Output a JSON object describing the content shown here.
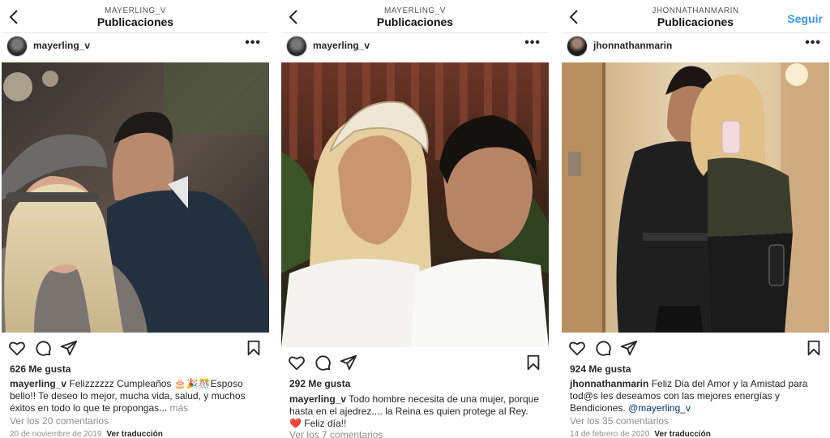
{
  "posts": [
    {
      "header_username": "MAYERLING_V",
      "header_title": "Publicaciones",
      "author": "mayerling_v",
      "menu_label": "•••",
      "likes": "626 Me gusta",
      "caption_user": "mayerling_v",
      "caption_text": "Felizzzzzz Cumpleaños 🎂🎉🎊Esposo bello!! Te deseo lo mejor, mucha vida, salud, y muchos éxitos en todo lo que te propongas...",
      "more_label": "más",
      "comments": "Ver los 20 comentarios",
      "date": "20 de noviembre de 2019",
      "translate": "Ver traducción"
    },
    {
      "header_username": "MAYERLING_V",
      "header_title": "Publicaciones",
      "author": "mayerling_v",
      "menu_label": "•••",
      "likes": "292 Me gusta",
      "caption_user": "mayerling_v",
      "caption_text": "Todo hombre necesita de una mujer, porque hasta en el ajedrez.... la Reina es quien protege al Rey.",
      "caption_heart": "❤️",
      "caption_tail": "Feliz día!!",
      "comments": "Ver los 7 comentarios"
    },
    {
      "header_username": "JHONNATHANMARIN",
      "header_title": "Publicaciones",
      "follow_label": "Seguir",
      "author": "jhonnathanmarin",
      "menu_label": "•••",
      "likes": "924 Me gusta",
      "caption_user": "jhonnathanmarin",
      "caption_text": "Feliz Dia del Amor y la Amistad para tod@s les deseamos con las mejores energías y Bendiciones.",
      "caption_mention": "@mayerling_v",
      "comments": "Ver los 35 comentarios",
      "date": "14 de febrero de 2020",
      "translate": "Ver traducción"
    }
  ],
  "icons": [
    "chevron-left-icon",
    "more-icon",
    "heart-icon",
    "comment-icon",
    "share-icon",
    "bookmark-icon"
  ],
  "colors": {
    "follow": "#3897f0",
    "muted": "#8e8e8e",
    "text": "#262626"
  }
}
